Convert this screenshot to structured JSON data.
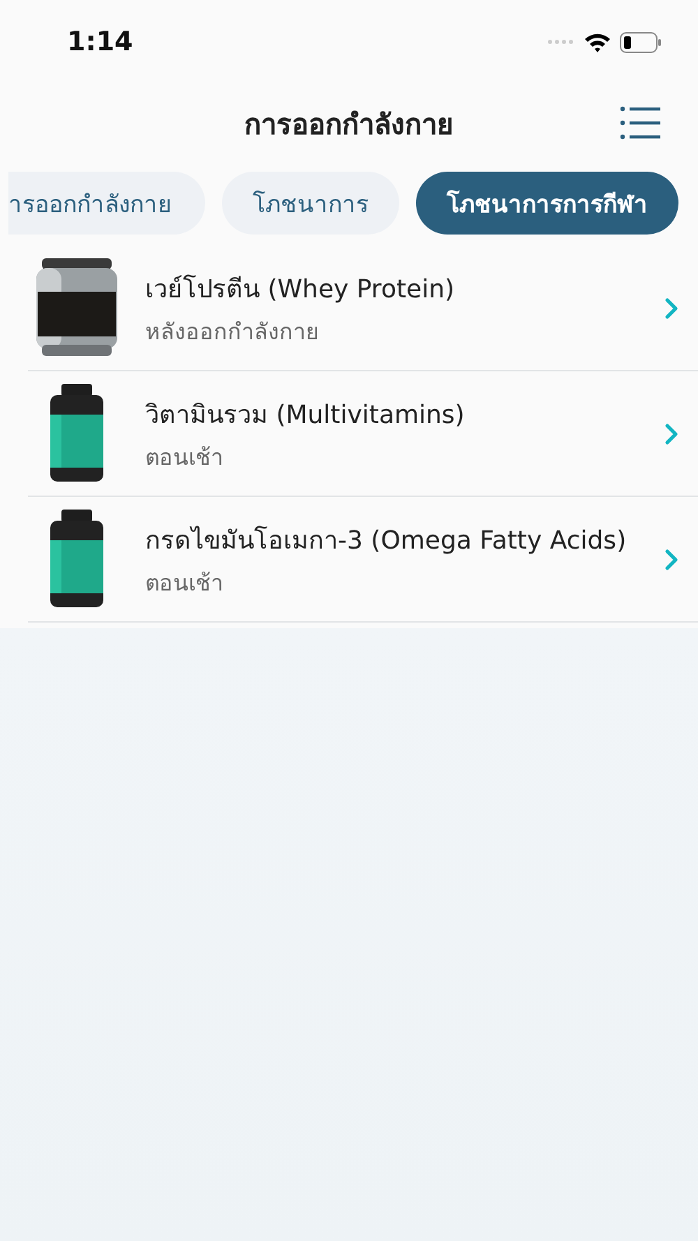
{
  "status_bar": {
    "time": "1:14"
  },
  "header": {
    "title": "การออกกำลังกาย"
  },
  "tabs": [
    {
      "label": "ารออกกำลังกาย",
      "selected": false
    },
    {
      "label": "โภชนาการ",
      "selected": false
    },
    {
      "label": "โภชนาการการกีฬา",
      "selected": true
    }
  ],
  "items": [
    {
      "title": "เวย์โปรตีน (Whey Protein)",
      "subtitle": "หลังออกกำลังกาย"
    },
    {
      "title": "วิตามินรวม (Multivitamins)",
      "subtitle": "ตอนเช้า"
    },
    {
      "title": "กรดไขมันโอเมกา-3 (Omega Fatty Acids)",
      "subtitle": "ตอนเช้า"
    }
  ]
}
